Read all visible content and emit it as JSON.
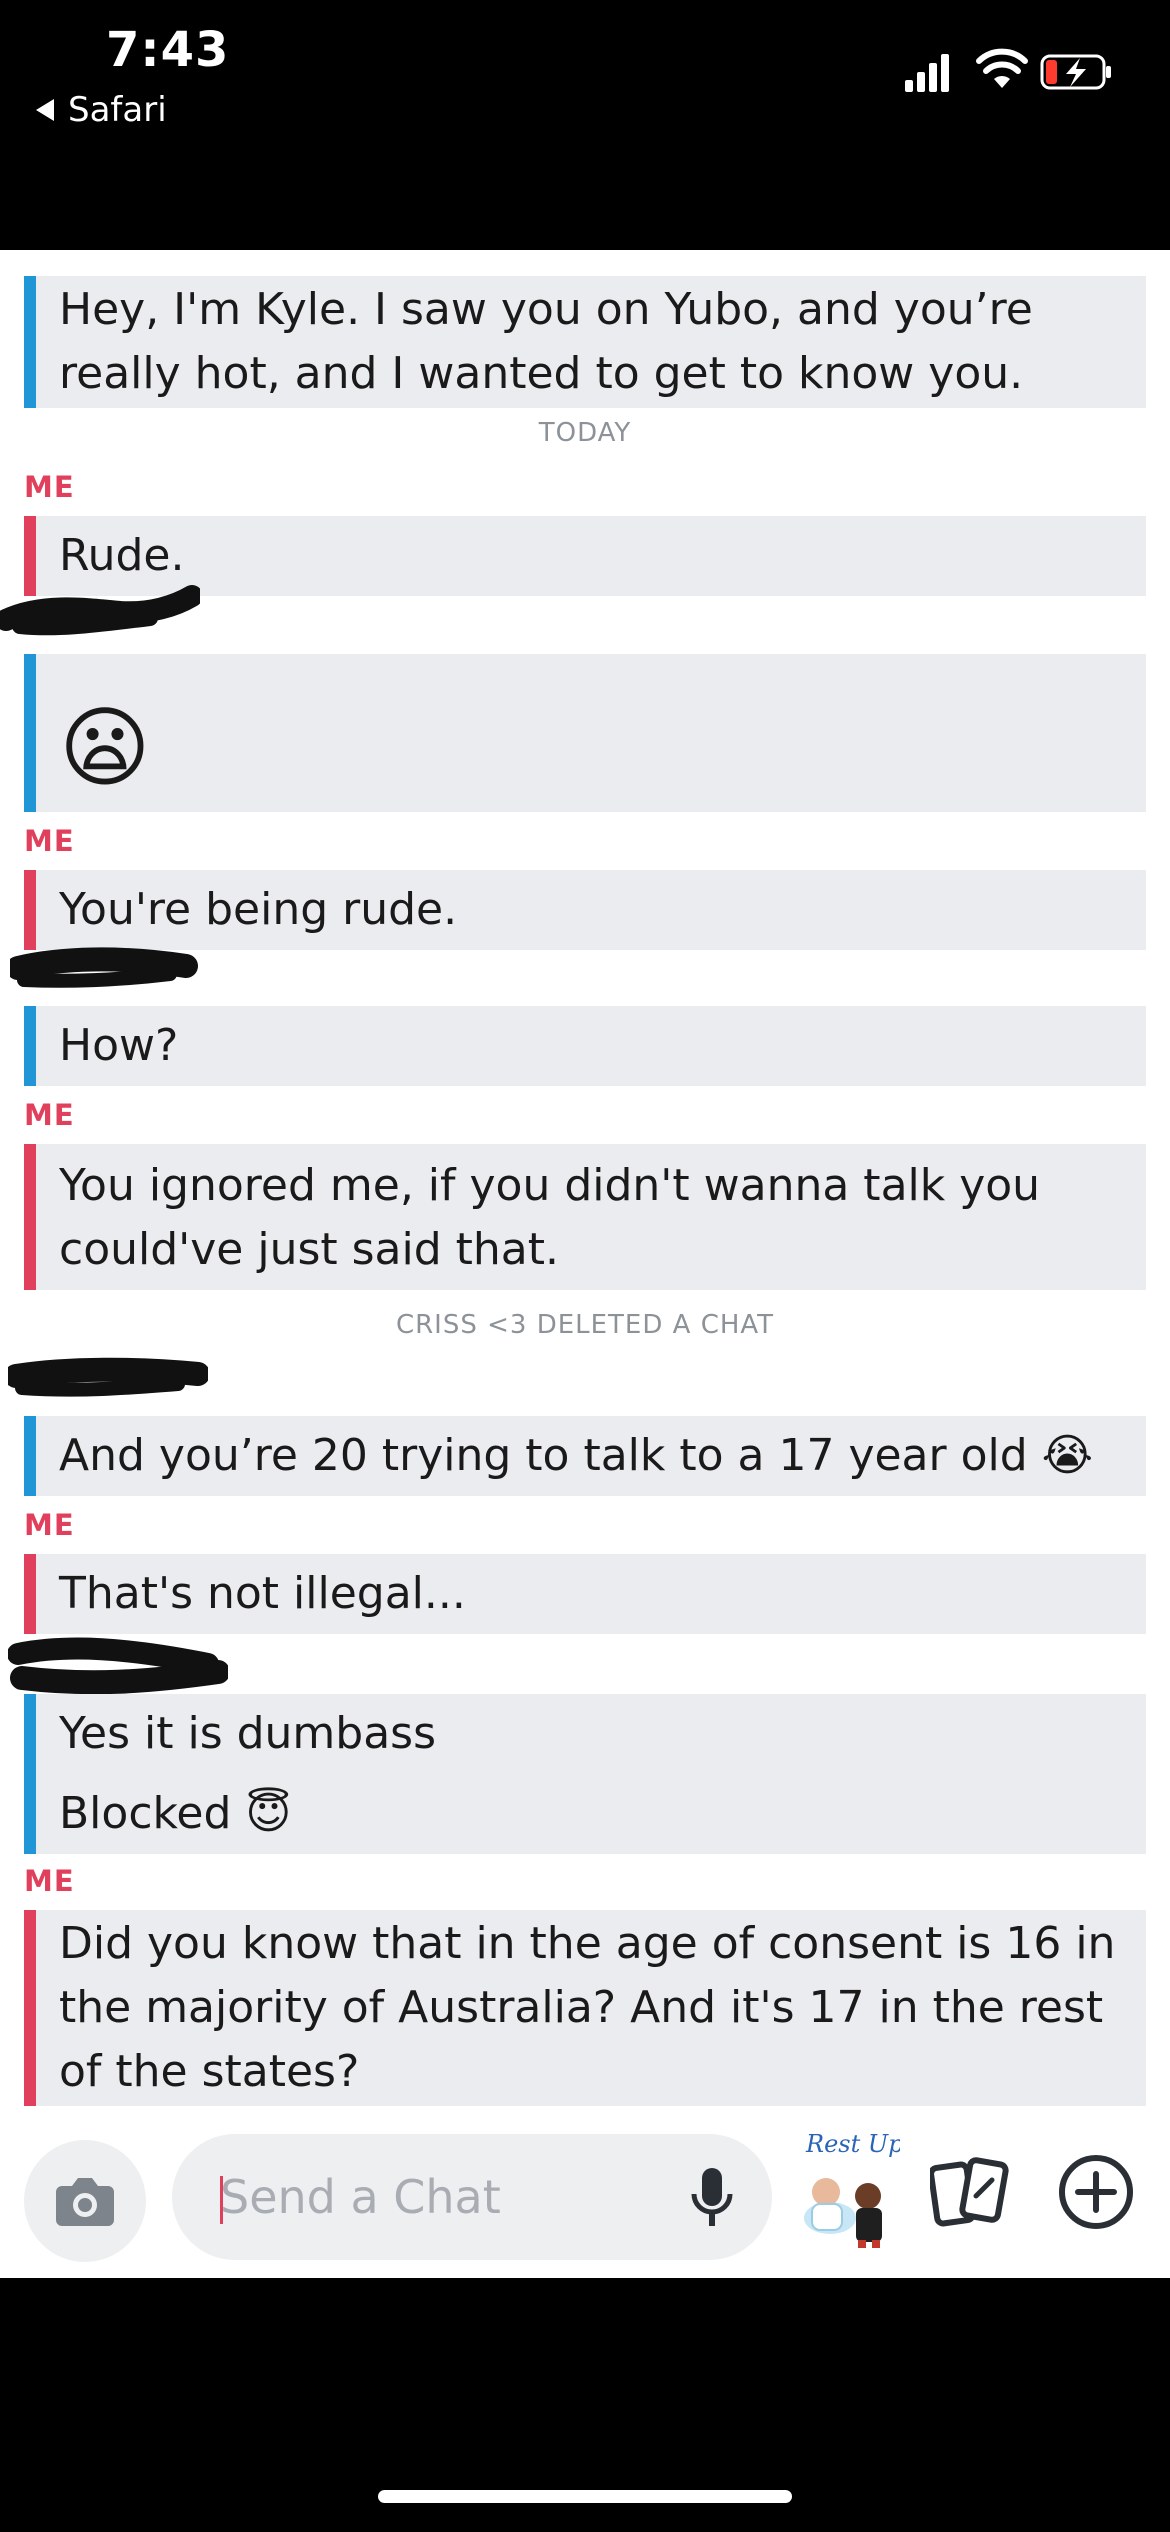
{
  "status_bar": {
    "time": "7:43",
    "back_app": "Safari"
  },
  "messages": [
    {
      "from": "them",
      "text": "Hey, I'm Kyle. I saw you on Yubo, and you’re really hot, and I wanted to get to know you."
    },
    {
      "from": "me",
      "text": "Rude."
    },
    {
      "from": "them",
      "text": "😦"
    },
    {
      "from": "me",
      "text": "You're being rude."
    },
    {
      "from": "them",
      "text": "How?"
    },
    {
      "from": "me",
      "text": "You ignored me, if you didn't wanna talk you could've just said that."
    },
    {
      "from": "them",
      "text": "And you’re 20 trying to talk to a 17 year old 😭"
    },
    {
      "from": "me",
      "text": "That's not illegal..."
    },
    {
      "from": "them",
      "lines": [
        "Yes it is dumbass",
        "Blocked 😇"
      ]
    },
    {
      "from": "me",
      "text": "Did you know that in the age of consent is 16 in the majority of Australia? And it's 17 in the rest of the states?"
    }
  ],
  "labels": {
    "me": "ME"
  },
  "system": {
    "today": "TODAY",
    "deleted": "CRISS <3 DELETED A CHAT"
  },
  "composer": {
    "placeholder": "Send a Chat",
    "bitmoji_text": "Rest Up"
  },
  "icons": [
    "signal-icon",
    "wifi-icon",
    "battery-charging-icon",
    "camera-icon",
    "microphone-icon",
    "bitmoji-sticker",
    "cards-icon",
    "plus-icon"
  ],
  "colors": {
    "me_accent": "#e0405c",
    "them_accent": "#2196d6",
    "bubble_bg": "#eaecef"
  }
}
